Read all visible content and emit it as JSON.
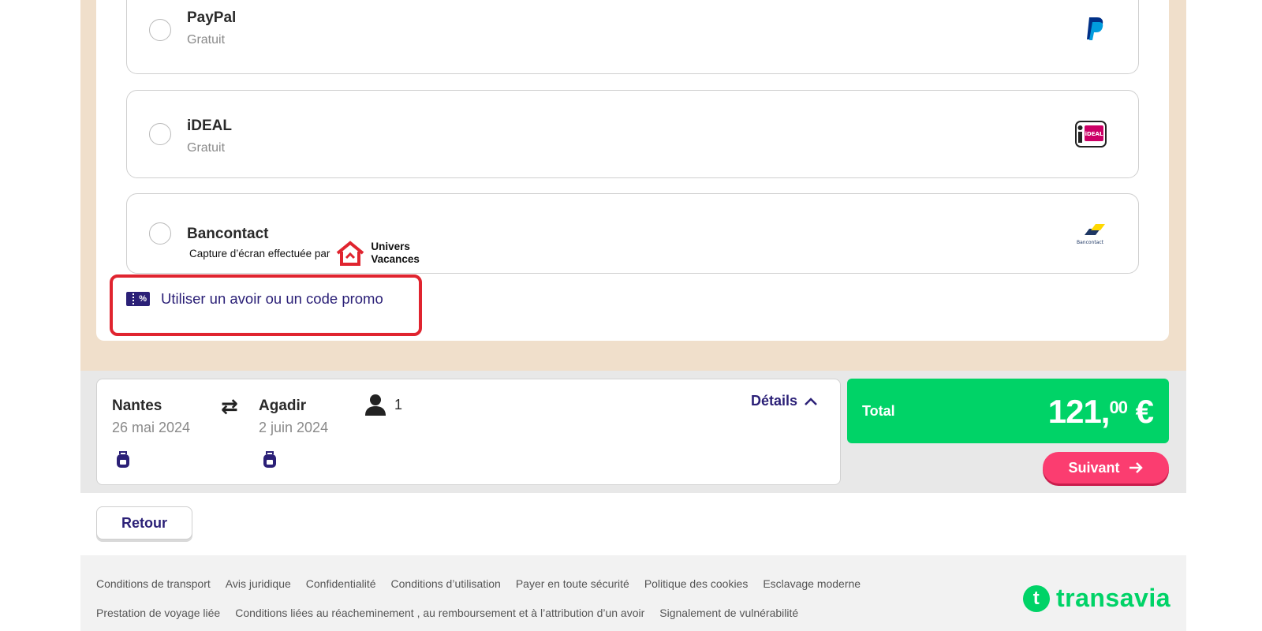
{
  "payment_options": [
    {
      "name": "PayPal",
      "price": "Gratuit",
      "logo": "paypal-logo"
    },
    {
      "name": "iDEAL",
      "price": "Gratuit",
      "logo": "ideal-logo"
    },
    {
      "name": "Bancontact",
      "price": "",
      "logo": "bancontact-logo"
    }
  ],
  "ideal_logo_text": "iDEAL",
  "bancontact_logo_text": "Bancontact",
  "watermark": {
    "text": "Capture d’écran effectuée par",
    "brand_line1": "Univers",
    "brand_line2": "Vacances"
  },
  "promo": {
    "label": "Utiliser un avoir ou un code promo",
    "icon_text": "%"
  },
  "trip": {
    "origin": "Nantes",
    "origin_date": "26 mai 2024",
    "destination": "Agadir",
    "destination_date": "2 juin 2024",
    "passengers": "1",
    "details_label": "Détails"
  },
  "total": {
    "label": "Total",
    "amount_main": "121,",
    "amount_cents": "00",
    "currency": " €"
  },
  "next_label": "Suivant",
  "back_label": "Retour",
  "footer": {
    "row1": [
      "Conditions de transport",
      "Avis juridique",
      "Confidentialité",
      "Conditions d’utilisation",
      "Payer en toute sécurité",
      "Politique des cookies",
      "Esclavage moderne"
    ],
    "row2": [
      "Prestation de voyage liée",
      "Conditions liées au réacheminement , au remboursement et à l’attribution d’un avoir",
      "Signalement de vulnérabilité"
    ],
    "brand": "transavia"
  },
  "colors": {
    "accent": "#2b2077",
    "total_bg": "#00d367",
    "next_bg": "#fb3d70",
    "highlight": "#e0242f"
  }
}
